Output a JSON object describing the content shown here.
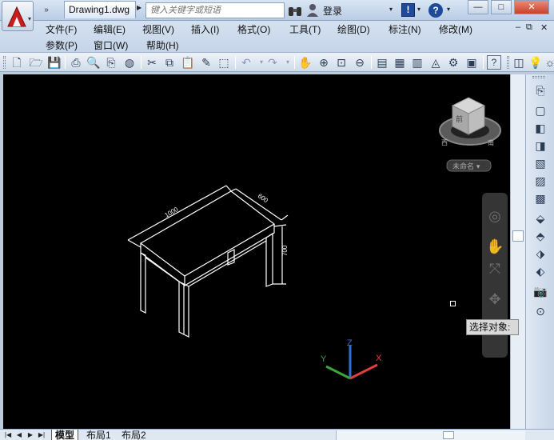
{
  "titlebar": {
    "document_tab": "Drawing1.dwg",
    "search_placeholder": "键入关键字或短语",
    "login_label": "登录",
    "help_label": "?",
    "exchange_label": "!",
    "minimize": "—",
    "restore": "□",
    "close": "✕"
  },
  "menu": {
    "row1": [
      "文件(F)",
      "编辑(E)",
      "视图(V)",
      "插入(I)",
      "格式(O)",
      "工具(T)",
      "绘图(D)",
      "标注(N)",
      "修改(M)"
    ],
    "row2": [
      "参数(P)",
      "窗口(W)",
      "帮助(H)"
    ],
    "doc_controls": [
      "–",
      "⧉",
      "✕"
    ]
  },
  "toolbar": {
    "icons": [
      "new-icon",
      "open-icon",
      "save-icon",
      "plot-icon",
      "plot-preview-icon",
      "publish-icon",
      "3d-print-icon",
      "cut-icon",
      "copy-icon",
      "paste-icon",
      "match-properties-icon",
      "block-editor-icon",
      "undo-icon",
      "redo-icon",
      "pan-icon",
      "zoom-realtime-icon",
      "zoom-window-icon",
      "zoom-previous-icon",
      "properties-icon",
      "design-center-icon",
      "tool-palettes-icon",
      "sheet-set-icon",
      "markup-icon",
      "quickcalc-icon",
      "help-icon",
      "light-icon"
    ]
  },
  "drawing": {
    "dim_length": "1000",
    "dim_width": "600",
    "dim_height": "700",
    "ucs_x": "X",
    "ucs_y": "Y",
    "ucs_z": "Z",
    "viewcube_face": "前",
    "viewcube_dir_w": "西",
    "viewcube_dir_s": "南",
    "wcs_label": "未命名 ▾"
  },
  "tooltip": {
    "text": "选择对象:"
  },
  "layout_tabs": {
    "model": "模型",
    "layout1": "布局1",
    "layout2": "布局2"
  },
  "colors": {
    "canvas": "#000000",
    "ucs_x": "#e0403a",
    "ucs_y": "#3aa63a",
    "ucs_z": "#2f6fd8",
    "chrome": "#c5d5e8"
  }
}
